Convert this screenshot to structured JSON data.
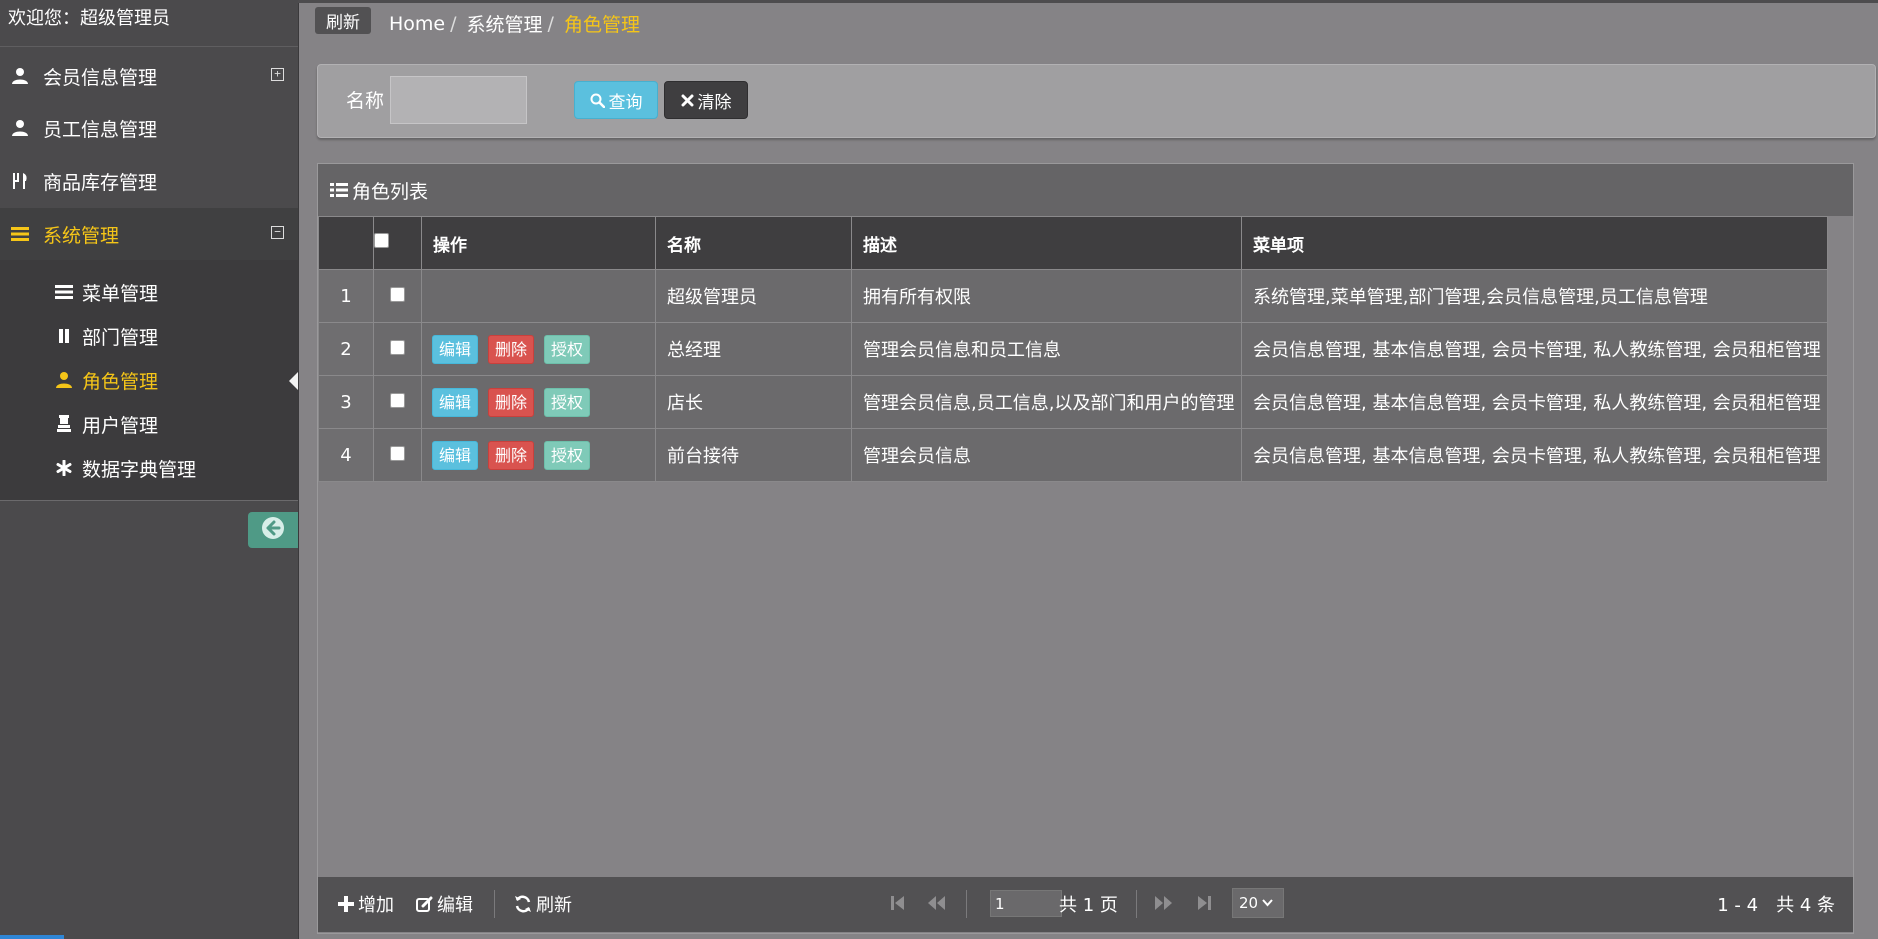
{
  "sidebar": {
    "welcome": "欢迎您：超级管理员",
    "items": [
      {
        "label": "会员信息管理",
        "icon": "user-icon",
        "toggle": "+"
      },
      {
        "label": "员工信息管理",
        "icon": "user-icon"
      },
      {
        "label": "商品库存管理",
        "icon": "cutlery-icon"
      },
      {
        "label": "系统管理",
        "icon": "list-icon",
        "toggle": "−"
      }
    ],
    "subitems": [
      {
        "label": "菜单管理",
        "icon": "list-icon"
      },
      {
        "label": "部门管理",
        "icon": "pause-icon"
      },
      {
        "label": "角色管理",
        "icon": "user-icon"
      },
      {
        "label": "用户管理",
        "icon": "king-icon"
      },
      {
        "label": "数据字典管理",
        "icon": "asterisk-icon"
      }
    ]
  },
  "topbar": {
    "refresh": "刷新",
    "breadcrumb": [
      "Home",
      "系统管理",
      "角色管理"
    ],
    "sep": "/"
  },
  "search": {
    "label": "名称",
    "input_value": "",
    "query_label": "查询",
    "clear_label": "清除"
  },
  "grid": {
    "title": "角色列表",
    "columns": [
      "操作",
      "名称",
      "描述",
      "菜单项"
    ],
    "rows": [
      {
        "num": "1",
        "name": "超级管理员",
        "desc": "拥有所有权限",
        "menus": "系统管理,菜单管理,部门管理,会员信息管理,员工信息管理",
        "actions": false
      },
      {
        "num": "2",
        "name": "总经理",
        "desc": "管理会员信息和员工信息",
        "menus": "会员信息管理, 基本信息管理, 会员卡管理, 私人教练管理, 会员租柜管理",
        "actions": true
      },
      {
        "num": "3",
        "name": "店长",
        "desc": "管理会员信息,员工信息,以及部门和用户的管理",
        "menus": "会员信息管理, 基本信息管理, 会员卡管理, 私人教练管理, 会员租柜管理",
        "actions": true
      },
      {
        "num": "4",
        "name": "前台接待",
        "desc": "管理会员信息",
        "menus": "会员信息管理, 基本信息管理, 会员卡管理, 私人教练管理, 会员租柜管理",
        "actions": true
      }
    ],
    "action_labels": {
      "edit": "编辑",
      "delete": "删除",
      "auth": "授权"
    }
  },
  "footer": {
    "add": "增加",
    "edit": "编辑",
    "refresh": "刷新",
    "page_value": "1",
    "page_total": "共 1 页",
    "page_size": "20",
    "record_info": "1 - 4　共 4 条"
  },
  "colors": {
    "accent": "#f5c518",
    "info": "#5bc0de",
    "danger": "#d9534f",
    "success_light": "#7fcab8"
  }
}
